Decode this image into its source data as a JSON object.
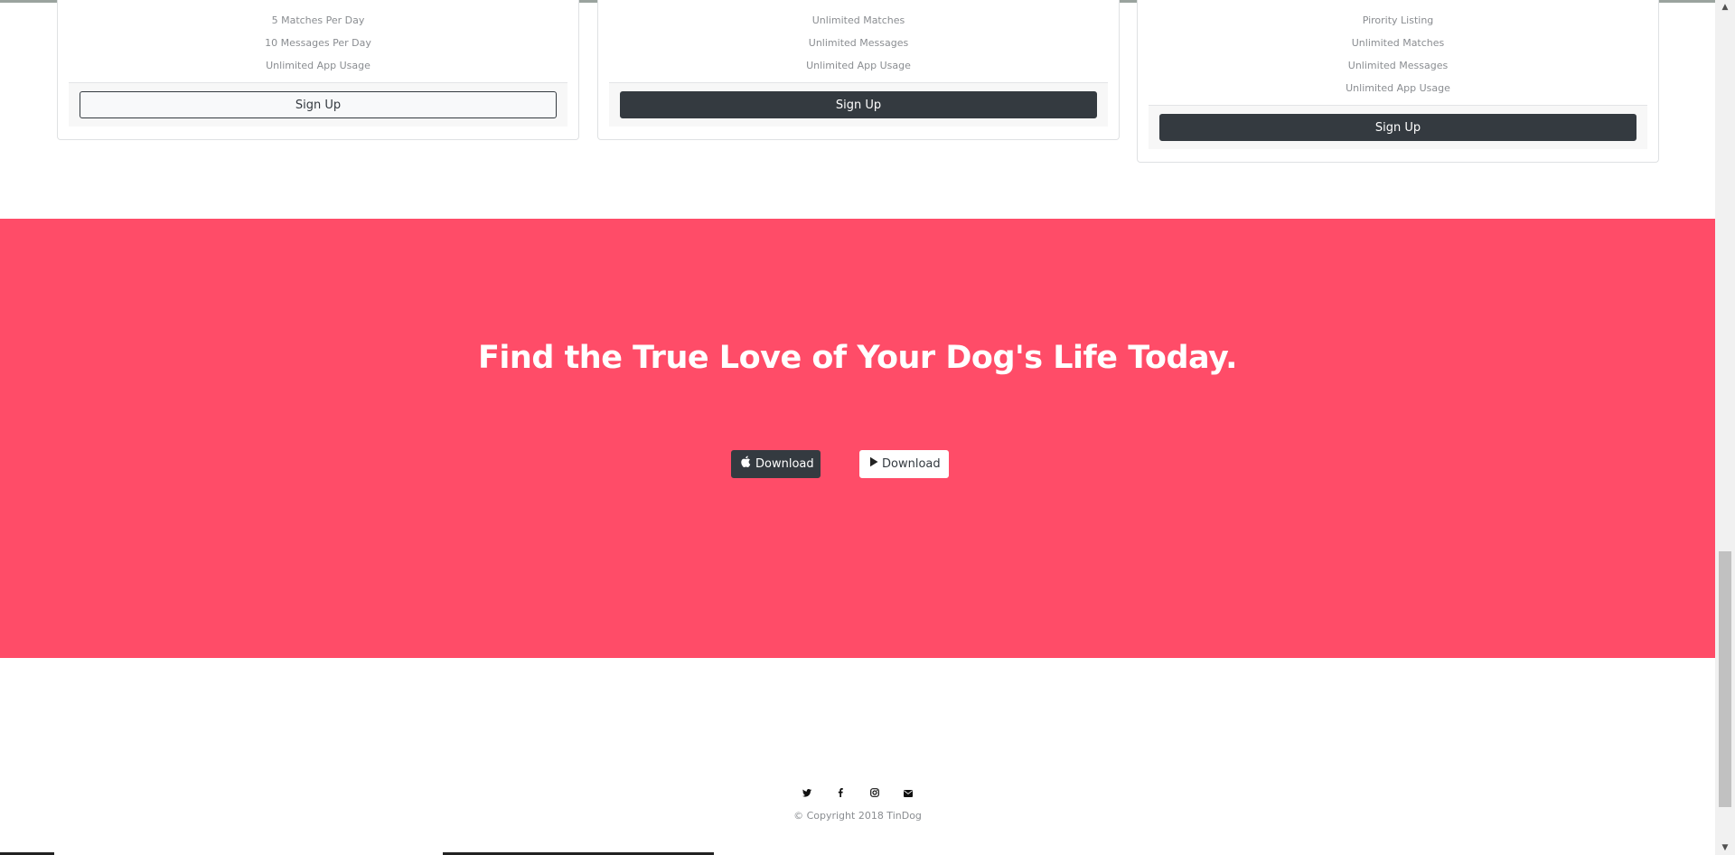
{
  "pricing": {
    "cards": [
      {
        "features": [
          "5 Matches Per Day",
          "10 Messages Per Day",
          "Unlimited App Usage"
        ],
        "button_label": "Sign Up",
        "button_style": "outline"
      },
      {
        "features": [
          "Unlimited Matches",
          "Unlimited Messages",
          "Unlimited App Usage"
        ],
        "button_label": "Sign Up",
        "button_style": "dark"
      },
      {
        "features": [
          "Pirority Listing",
          "Unlimited Matches",
          "Unlimited Messages",
          "Unlimited App Usage"
        ],
        "button_label": "Sign Up",
        "button_style": "dark"
      }
    ]
  },
  "cta": {
    "title": "Find the True Love of Your Dog's Life Today.",
    "apple_button_label": "Download",
    "google_button_label": "Download",
    "background_color": "#ff4c68"
  },
  "footer": {
    "icons": [
      "twitter-icon",
      "facebook-icon",
      "instagram-icon",
      "envelope-icon"
    ],
    "copyright": "© Copyright 2018 TinDog"
  },
  "colors": {
    "dark": "#343a40",
    "muted_text": "#8a8d91"
  }
}
